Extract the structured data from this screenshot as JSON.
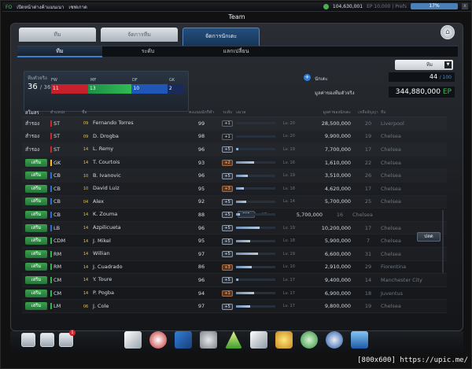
{
  "topbar": {
    "tag": "FO",
    "link1": "เปิดหน้าต่างค้าแมนเนา",
    "link2": "เซฟเกาต",
    "money": "104,630,001",
    "status_blur": "EP 10,000 | Prefs",
    "battery": "17%",
    "close": "x"
  },
  "window": {
    "title": "Team"
  },
  "tabs": [
    {
      "label": "ทีม"
    },
    {
      "label": "จัดการทีม"
    },
    {
      "label": "จัดการนักเตะ"
    }
  ],
  "subtabs": [
    {
      "label": "ทีม"
    },
    {
      "label": "ระดับ"
    },
    {
      "label": "แลกเปลี่ยน"
    }
  ],
  "team_select": {
    "value": "ทีม"
  },
  "summary": {
    "label": "ทีมตัวจริง",
    "count": "36",
    "max": "/ 36",
    "positions": [
      {
        "label": "FW",
        "count": "11"
      },
      {
        "label": "MF",
        "count": "13"
      },
      {
        "label": "DF",
        "count": "10"
      },
      {
        "label": "GK",
        "count": "2"
      }
    ]
  },
  "players_info": {
    "label": "นักเตะ",
    "count": "44",
    "max": "/ 100",
    "total_label": "มูลค่าของทีมตัวจริง",
    "total_value": "344,880,000",
    "currency": "EP"
  },
  "table_headers": {
    "status": "สโมสร",
    "position": "ตำแหน่ง",
    "name": "ชื่อ",
    "ovr": "คะแนนนักกีฬา",
    "level": "ระดับ",
    "exp": "เลเวล",
    "value": "มูลค่าของนักเตะ",
    "seasons": "เหลือสัญญา",
    "team": "ทีม"
  },
  "rows": [
    {
      "status": "สำรอง",
      "starter": false,
      "pos": "ST",
      "posType": "fw",
      "season": "09",
      "name": "Fernando Torres",
      "ovr": "99",
      "lv": "+1",
      "lvType": "",
      "exp": 0,
      "lvText": "Lv. 20",
      "value": "28,500,000",
      "seasons": "20",
      "team": "Liverpool"
    },
    {
      "status": "สำรอง",
      "starter": false,
      "pos": "ST",
      "posType": "fw",
      "season": "09",
      "name": "D. Drogba",
      "ovr": "98",
      "lv": "+1",
      "lvType": "",
      "exp": 0,
      "lvText": "Lv. 20",
      "value": "9,900,000",
      "seasons": "19",
      "team": "Chelsea"
    },
    {
      "status": "สำรอง",
      "starter": false,
      "pos": "ST",
      "posType": "fw",
      "season": "14",
      "name": "L. Remy",
      "ovr": "96",
      "lv": "+5",
      "lvType": "up",
      "exp": 0.05,
      "lvText": "Lv. 19",
      "value": "7,700,000",
      "seasons": "17",
      "team": "Chelsea"
    },
    {
      "status": "เสริม",
      "starter": true,
      "pos": "GK",
      "posType": "gk",
      "season": "14",
      "name": "T. Courtois",
      "ovr": "93",
      "lv": "+2",
      "lvType": "down",
      "exp": 0.45,
      "lvText": "Lv. 16",
      "value": "1,610,000",
      "seasons": "22",
      "team": "Chelsea"
    },
    {
      "status": "เสริม",
      "starter": true,
      "pos": "CB",
      "posType": "df",
      "season": "10",
      "name": "B. Ivanovic",
      "ovr": "96",
      "lv": "+5",
      "lvType": "up",
      "exp": 0.3,
      "lvText": "Lv. 19",
      "value": "3,510,000",
      "seasons": "26",
      "team": "Chelsea"
    },
    {
      "status": "เสริม",
      "starter": true,
      "pos": "CB",
      "posType": "df",
      "season": "10",
      "name": "David Luiz",
      "ovr": "95",
      "lv": "+3",
      "lvType": "down",
      "exp": 0.2,
      "lvText": "Lv. 18",
      "value": "4,620,000",
      "seasons": "17",
      "team": "Chelsea"
    },
    {
      "status": "เสริม",
      "starter": true,
      "pos": "CB",
      "posType": "df",
      "season": "04",
      "name": "Alex",
      "ovr": "92",
      "lv": "+5",
      "lvType": "up",
      "exp": 0.25,
      "lvText": "Lv. 14",
      "value": "5,700,000",
      "seasons": "25",
      "team": "Chelsea"
    },
    {
      "status": "เสริม",
      "starter": true,
      "pos": "CB",
      "posType": "df",
      "season": "14",
      "name": "K. Zouma",
      "ovr": "88",
      "lv": "+5",
      "lvType": "up",
      "exp": 0.1,
      "lvText": "Lv. 17",
      "value": "5,700,000",
      "seasons": "16",
      "team": "Chelsea",
      "swap": "ขาย"
    },
    {
      "status": "เสริม",
      "starter": true,
      "pos": "LB",
      "posType": "df",
      "season": "14",
      "name": "Azpilicueta",
      "ovr": "96",
      "lv": "+5",
      "lvType": "up",
      "exp": 0.6,
      "lvText": "Lv. 19",
      "value": "10,200,000",
      "seasons": "17",
      "team": "Chelsea"
    },
    {
      "status": "เสริม",
      "starter": true,
      "pos": "CDM",
      "posType": "mf",
      "season": "14",
      "name": "J. Mikel",
      "ovr": "95",
      "lv": "+5",
      "lvType": "up",
      "exp": 0.35,
      "lvText": "Lv. 18",
      "value": "5,900,000",
      "seasons": "7",
      "team": "Chelsea"
    },
    {
      "status": "เสริม",
      "starter": true,
      "pos": "RM",
      "posType": "mf",
      "season": "14",
      "name": "Willian",
      "ovr": "97",
      "lv": "+5",
      "lvType": "up",
      "exp": 0.55,
      "lvText": "Lv. 19",
      "value": "6,600,000",
      "seasons": "31",
      "team": "Chelsea"
    },
    {
      "status": "เสริม",
      "starter": true,
      "pos": "RM",
      "posType": "mf",
      "season": "14",
      "name": "J. Cuadrado",
      "ovr": "86",
      "lv": "+3",
      "lvType": "down",
      "exp": 0.4,
      "lvText": "Lv. 10",
      "value": "2,910,000",
      "seasons": "29",
      "team": "Fiorentina"
    },
    {
      "status": "เสริม",
      "starter": true,
      "pos": "CM",
      "posType": "mf",
      "season": "14",
      "name": "Y. Toure",
      "ovr": "96",
      "lv": "+5",
      "lvType": "up",
      "exp": 0.05,
      "lvText": "Lv. 17",
      "value": "9,400,000",
      "seasons": "14",
      "team": "Manchester City"
    },
    {
      "status": "เสริม",
      "starter": true,
      "pos": "CM",
      "posType": "mf",
      "season": "14",
      "name": "P. Pogba",
      "ovr": "94",
      "lv": "+1",
      "lvType": "down",
      "exp": 0.45,
      "lvText": "Lv. 17",
      "value": "6,900,000",
      "seasons": "18",
      "team": "Juventus"
    },
    {
      "status": "เสริม",
      "starter": true,
      "pos": "LM",
      "posType": "mf",
      "season": "06",
      "name": "J. Cole",
      "ovr": "97",
      "lv": "+5",
      "lvType": "up",
      "exp": 0.35,
      "lvText": "Lv. 17",
      "value": "9,800,000",
      "seasons": "19",
      "team": "Chelsea"
    }
  ],
  "release_button": "ปลด",
  "dock": {
    "badge": "1"
  },
  "watermark": "[800x600] https://upic.me/"
}
